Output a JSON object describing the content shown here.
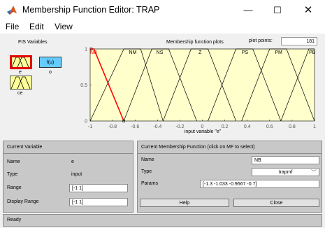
{
  "window": {
    "title": "Membership Function Editor: TRAP",
    "controls": {
      "minimize": "—",
      "maximize": "☐",
      "close": "✕"
    }
  },
  "menu": {
    "items": [
      "File",
      "Edit",
      "View"
    ]
  },
  "fis_panel": {
    "label": "FIS Variables",
    "variables": [
      {
        "name": "e",
        "selected": true,
        "color": "#ffff99"
      },
      {
        "name": "f(u)",
        "sub": "o",
        "color": "#66ccff"
      },
      {
        "name": "ce",
        "color": "#ffff99"
      }
    ]
  },
  "plot": {
    "label": "Membership function plots",
    "plot_points_label": "plot points:",
    "plot_points_value": "181",
    "xlabel": "input variable \"e\"",
    "x_ticks": [
      "-1",
      "-0.8",
      "-0.6",
      "-0.4",
      "-0.2",
      "0",
      "0.2",
      "0.4",
      "0.6",
      "0.8",
      "1"
    ],
    "y_ticks": [
      "0",
      "0.5",
      "1"
    ],
    "mf_names": [
      "NB",
      "NM",
      "NS",
      "Z",
      "PS",
      "PM",
      "PB"
    ],
    "selected_mf": "NB",
    "colors": {
      "background": "#ffffcc",
      "line": "#000000",
      "selected": "#ff0000"
    }
  },
  "chart_data": {
    "type": "line",
    "xlabel": "input variable \"e\"",
    "xlim": [
      -1,
      1
    ],
    "ylim": [
      0,
      1
    ],
    "series": [
      {
        "name": "NB",
        "x": [
          -1.3,
          -1.033,
          -0.9667,
          -0.7
        ],
        "y": [
          1,
          1,
          1,
          0
        ]
      },
      {
        "name": "NM",
        "x": [
          -1,
          -0.7,
          -0.55,
          -0.35
        ],
        "y": [
          0,
          1,
          1,
          0
        ]
      },
      {
        "name": "NS",
        "x": [
          -0.7,
          -0.45,
          -0.3,
          -0.05
        ],
        "y": [
          0,
          1,
          1,
          0
        ]
      },
      {
        "name": "Z",
        "x": [
          -0.35,
          -0.1,
          0.05,
          0.3
        ],
        "y": [
          0,
          1,
          1,
          0
        ]
      },
      {
        "name": "PS",
        "x": [
          0.05,
          0.3,
          0.45,
          0.7
        ],
        "y": [
          0,
          1,
          1,
          0
        ]
      },
      {
        "name": "PM",
        "x": [
          0.35,
          0.6,
          0.75,
          1.0
        ],
        "y": [
          0,
          1,
          1,
          0
        ]
      },
      {
        "name": "PB",
        "x": [
          0.7,
          0.95,
          1.1,
          1.3
        ],
        "y": [
          0,
          1,
          1,
          0
        ]
      }
    ]
  },
  "current_variable": {
    "header": "Current Variable",
    "name_label": "Name",
    "name_value": "e",
    "type_label": "Type",
    "type_value": "input",
    "range_label": "Range",
    "range_value": "[-1 1]",
    "display_range_label": "Display Range",
    "display_range_value": "[-1 1]"
  },
  "current_mf": {
    "header": "Current Membership Function (click on MF to select)",
    "name_label": "Name",
    "name_value": "NB",
    "type_label": "Type",
    "type_value": "trapmf",
    "params_label": "Params",
    "params_value": "[-1.3 -1.033 -0.9667 -0.7]"
  },
  "buttons": {
    "help": "Help",
    "close": "Close"
  },
  "status": "Ready"
}
